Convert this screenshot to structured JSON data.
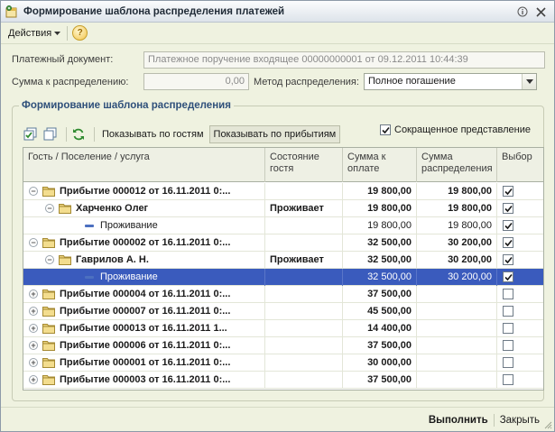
{
  "window": {
    "title": "Формирование шаблона распределения платежей"
  },
  "menu": {
    "actions": "Действия"
  },
  "form": {
    "doc_label": "Платежный документ:",
    "doc_value": "Платежное поручение входящее 00000000001 от 09.12.2011 10:44:39",
    "sum_label": "Сумма к распределению:",
    "sum_value": "0,00",
    "method_label": "Метод распределения:",
    "method_value": "Полное погашение"
  },
  "group": {
    "title": "Формирование шаблона распределения",
    "show_by_guests": "Показывать по гостям",
    "show_by_arrivals": "Показывать по прибытиям",
    "short_view": "Сокращенное представление"
  },
  "table": {
    "columns": [
      "Гость / Поселение / услуга",
      "Состояние гостя",
      "Сумма к оплате",
      "Сумма распределения",
      "Выбор"
    ],
    "rows": [
      {
        "level": 0,
        "expand": "minus",
        "icon": "folder",
        "name": "Прибытие 000012 от 16.11.2011 0:...",
        "state": "",
        "sum": "19 800,00",
        "dist": "19 800,00",
        "checked": true,
        "bold": true
      },
      {
        "level": 1,
        "expand": "minus",
        "icon": "folder",
        "name": "Харченко Олег",
        "state": "Проживает",
        "sum": "19 800,00",
        "dist": "19 800,00",
        "checked": true,
        "bold": true
      },
      {
        "level": 2,
        "expand": "",
        "icon": "leaf",
        "name": "Проживание",
        "state": "",
        "sum": "19 800,00",
        "dist": "19 800,00",
        "checked": true,
        "bold": false
      },
      {
        "level": 0,
        "expand": "minus",
        "icon": "folder",
        "name": "Прибытие 000002 от 16.11.2011 0:...",
        "state": "",
        "sum": "32 500,00",
        "dist": "30 200,00",
        "checked": true,
        "bold": true
      },
      {
        "level": 1,
        "expand": "minus",
        "icon": "folder",
        "name": "Гаврилов А. Н.",
        "state": "Проживает",
        "sum": "32 500,00",
        "dist": "30 200,00",
        "checked": true,
        "bold": true
      },
      {
        "level": 2,
        "expand": "",
        "icon": "leaf",
        "name": "Проживание",
        "state": "",
        "sum": "32 500,00",
        "dist": "30 200,00",
        "checked": true,
        "bold": false,
        "selected": true
      },
      {
        "level": 0,
        "expand": "plus",
        "icon": "folder",
        "name": "Прибытие 000004 от 16.11.2011 0:...",
        "state": "",
        "sum": "37 500,00",
        "dist": "",
        "checked": false,
        "bold": true
      },
      {
        "level": 0,
        "expand": "plus",
        "icon": "folder",
        "name": "Прибытие 000007 от 16.11.2011 0:...",
        "state": "",
        "sum": "45 500,00",
        "dist": "",
        "checked": false,
        "bold": true
      },
      {
        "level": 0,
        "expand": "plus",
        "icon": "folder",
        "name": "Прибытие 000013 от 16.11.2011 1...",
        "state": "",
        "sum": "14 400,00",
        "dist": "",
        "checked": false,
        "bold": true
      },
      {
        "level": 0,
        "expand": "plus",
        "icon": "folder",
        "name": "Прибытие 000006 от 16.11.2011 0:...",
        "state": "",
        "sum": "37 500,00",
        "dist": "",
        "checked": false,
        "bold": true
      },
      {
        "level": 0,
        "expand": "plus",
        "icon": "folder",
        "name": "Прибытие 000001 от 16.11.2011 0:...",
        "state": "",
        "sum": "30 000,00",
        "dist": "",
        "checked": false,
        "bold": true
      },
      {
        "level": 0,
        "expand": "plus",
        "icon": "folder",
        "name": "Прибытие 000003 от 16.11.2011 0:...",
        "state": "",
        "sum": "37 500,00",
        "dist": "",
        "checked": false,
        "bold": true
      }
    ]
  },
  "footer": {
    "execute": "Выполнить",
    "close": "Закрыть"
  },
  "colors": {
    "accent": "#2e4f7a",
    "selection": "#3a5bbd",
    "background": "#eff2e0"
  }
}
